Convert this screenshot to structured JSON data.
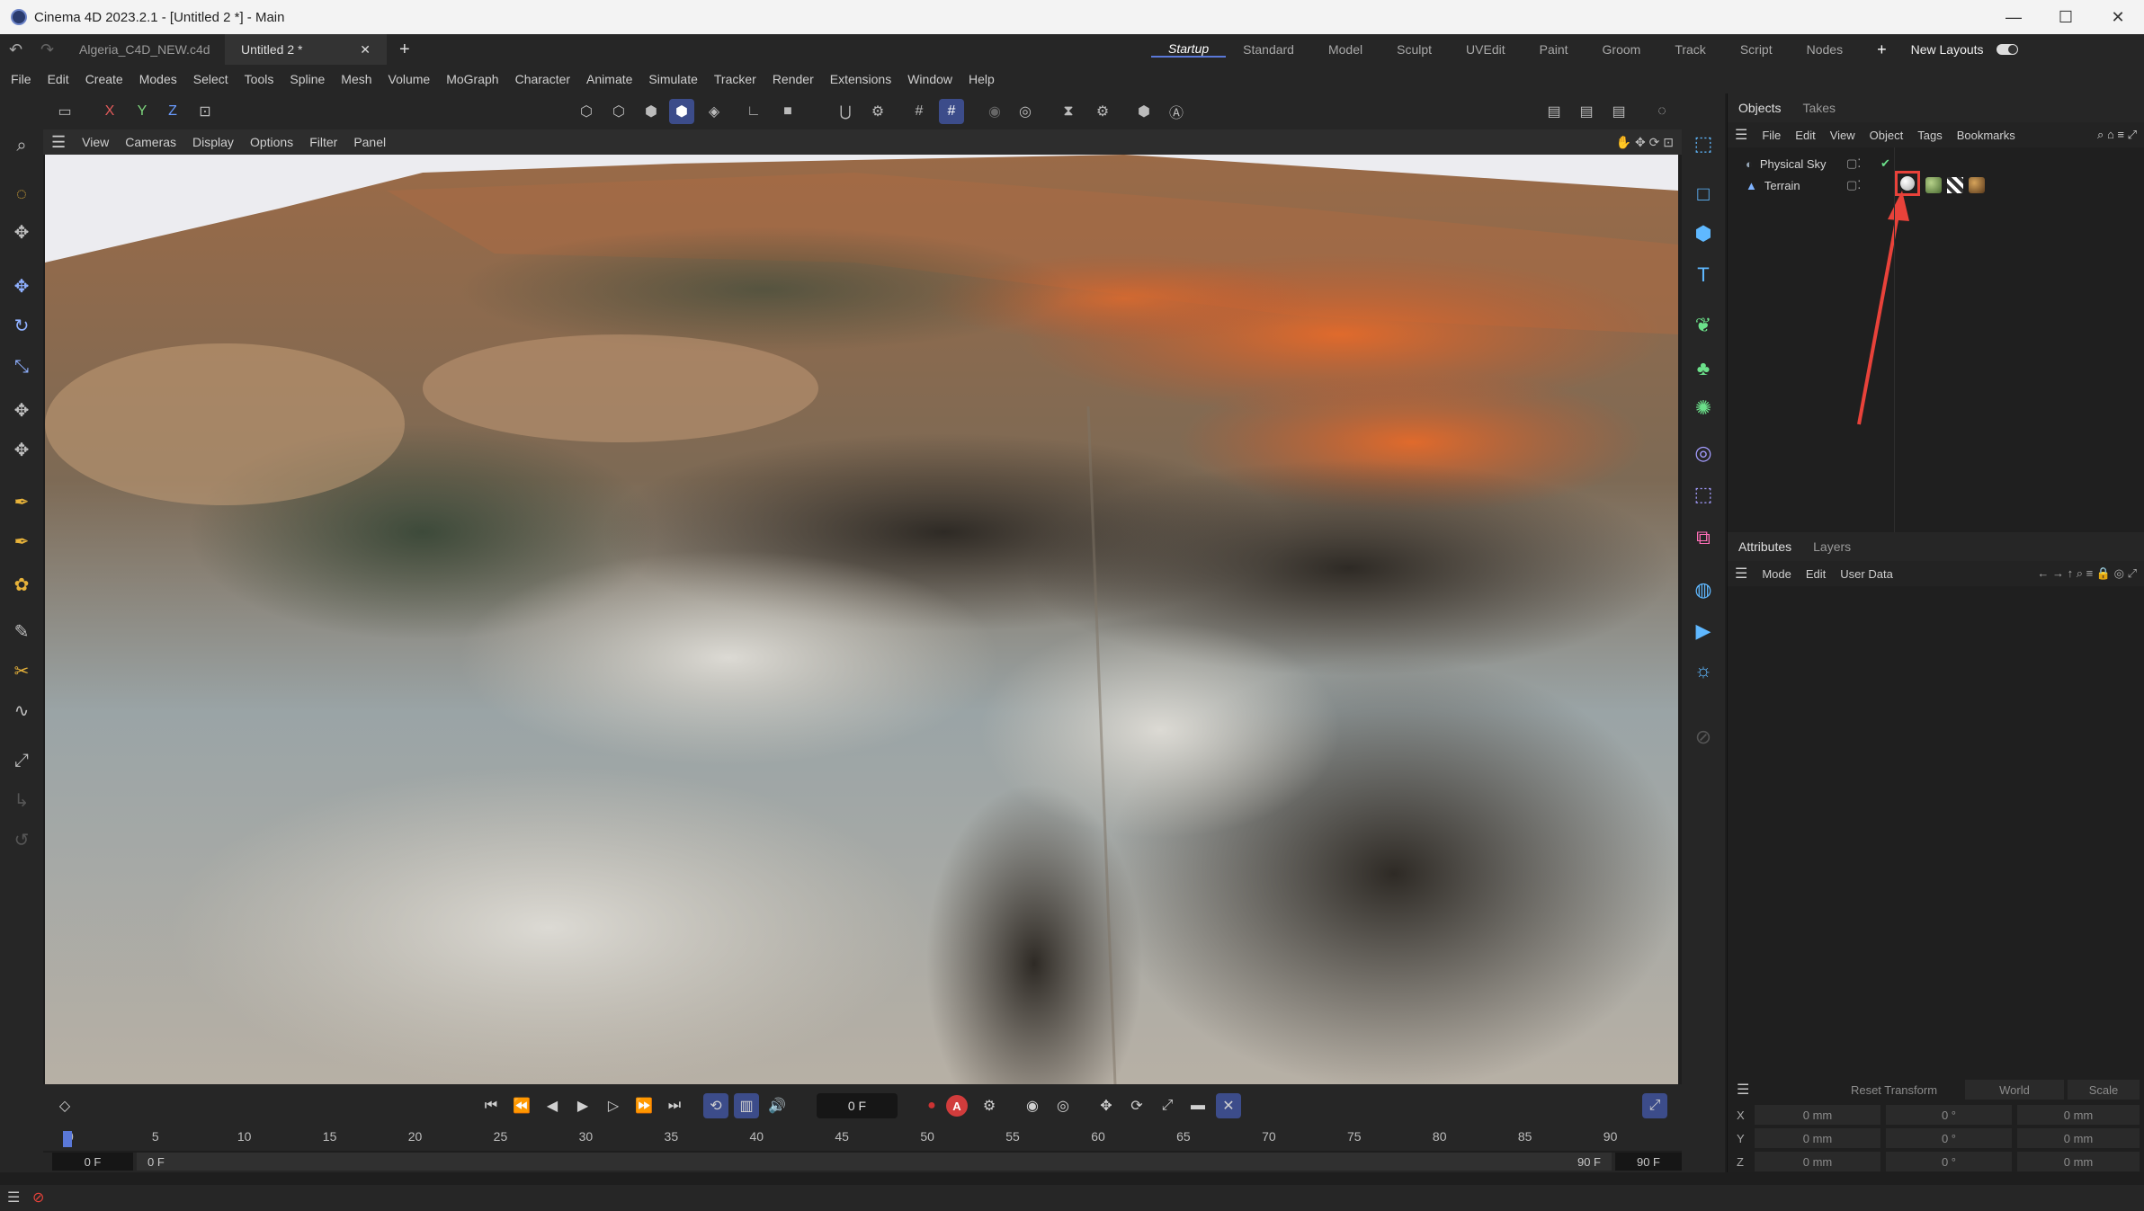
{
  "window": {
    "title": "Cinema 4D 2023.2.1 - [Untitled 2 *] - Main",
    "minimize": "—",
    "maximize": "☐",
    "close": "✕"
  },
  "doc_tabs": [
    {
      "label": "Algeria_C4D_NEW.c4d"
    },
    {
      "label": "Untitled 2 *"
    }
  ],
  "tab_add": "+",
  "layouts": [
    "Startup",
    "Standard",
    "Model",
    "Sculpt",
    "UVEdit",
    "Paint",
    "Groom",
    "Track",
    "Script",
    "Nodes"
  ],
  "layouts_add": "+",
  "new_layouts": "New Layouts",
  "menu": [
    "File",
    "Edit",
    "Create",
    "Modes",
    "Select",
    "Tools",
    "Spline",
    "Mesh",
    "Volume",
    "MoGraph",
    "Character",
    "Animate",
    "Simulate",
    "Tracker",
    "Render",
    "Extensions",
    "Window",
    "Help"
  ],
  "axis_buttons": [
    "X",
    "Y",
    "Z"
  ],
  "viewport_menu": [
    "View",
    "Cameras",
    "Display",
    "Options",
    "Filter",
    "Panel"
  ],
  "objects_panel": {
    "tabs": [
      "Objects",
      "Takes"
    ],
    "menu": [
      "File",
      "Edit",
      "View",
      "Object",
      "Tags",
      "Bookmarks"
    ],
    "objects": [
      {
        "name": "Physical Sky"
      },
      {
        "name": "Terrain"
      }
    ]
  },
  "attributes_panel": {
    "tabs": [
      "Attributes",
      "Layers"
    ],
    "menu": [
      "Mode",
      "Edit",
      "User Data"
    ]
  },
  "coordinates": {
    "reset_transform": "Reset Transform",
    "space": "World",
    "mode": "Scale",
    "rows": [
      {
        "axis": "X",
        "pos": "0 mm",
        "rot": "0 °",
        "size": "0 mm"
      },
      {
        "axis": "Y",
        "pos": "0 mm",
        "rot": "0 °",
        "size": "0 mm"
      },
      {
        "axis": "Z",
        "pos": "0 mm",
        "rot": "0 °",
        "size": "0 mm"
      }
    ]
  },
  "timeline": {
    "current_frame": "0 F",
    "ticks": [
      "0",
      "5",
      "10",
      "15",
      "20",
      "25",
      "30",
      "35",
      "40",
      "45",
      "50",
      "55",
      "60",
      "65",
      "70",
      "75",
      "80",
      "85",
      "90"
    ],
    "start": "0 F",
    "start2": "0 F",
    "end": "90 F",
    "end2": "90 F",
    "auto_key": "A"
  },
  "colors": {
    "accent": "#3c4c8a",
    "highlight_arrow": "#e8423a",
    "layout_active": "#5a78d8"
  }
}
